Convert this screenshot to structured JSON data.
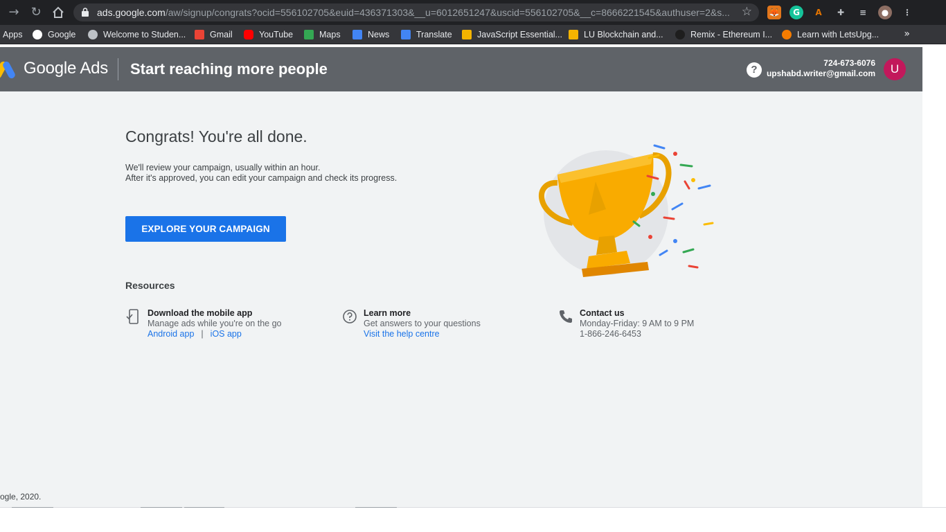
{
  "browser": {
    "url_host": "ads.google.com",
    "url_path": "/aw/signup/congrats?ocid=556102705&euid=436371303&__u=6012651247&uscid=556102705&__c=8666221545&authuser=2&s...",
    "bookmarks": [
      {
        "label": "Apps",
        "icon": "apps-grid-icon",
        "color": "#4285f4"
      },
      {
        "label": "Google",
        "icon": "google-g-icon",
        "color": "#ffffff"
      },
      {
        "label": "Welcome to Studen...",
        "icon": "globe-icon",
        "color": "#bdc1c6"
      },
      {
        "label": "Gmail",
        "icon": "gmail-icon",
        "color": "#ea4335"
      },
      {
        "label": "YouTube",
        "icon": "youtube-icon",
        "color": "#ff0000"
      },
      {
        "label": "Maps",
        "icon": "maps-icon",
        "color": "#34a853"
      },
      {
        "label": "News",
        "icon": "news-icon",
        "color": "#4285f4"
      },
      {
        "label": "Translate",
        "icon": "translate-icon",
        "color": "#4285f4"
      },
      {
        "label": "JavaScript Essential...",
        "icon": "slides-icon",
        "color": "#f4b400"
      },
      {
        "label": "LU Blockchain and...",
        "icon": "slides-icon",
        "color": "#f4b400"
      },
      {
        "label": "Remix - Ethereum I...",
        "icon": "remix-icon",
        "color": "#1e1e1e"
      },
      {
        "label": "Learn with LetsUpg...",
        "icon": "letsupgrade-icon",
        "color": "#f57c00"
      }
    ],
    "more_bookmarks": "»"
  },
  "header": {
    "product": "Google Ads",
    "page_title": "Start reaching more people",
    "help_glyph": "?",
    "account_phone": "724-673-6076",
    "account_email": "upshabd.writer@gmail.com",
    "avatar_letter": "U"
  },
  "main": {
    "heading": "Congrats! You're all done.",
    "desc_line1": "We'll review your campaign, usually within an hour.",
    "desc_line2": "After it's approved, you can edit your campaign and check its progress.",
    "cta": "EXPLORE YOUR CAMPAIGN",
    "resources_title": "Resources",
    "resources": {
      "mobile": {
        "title": "Download the mobile app",
        "desc": "Manage ads while you're on the go",
        "link_android": "Android app",
        "separator": "|",
        "link_ios": "iOS app"
      },
      "learn": {
        "title": "Learn more",
        "desc": "Get answers to your questions",
        "link": "Visit the help centre"
      },
      "contact": {
        "title": "Contact us",
        "hours": "Monday-Friday: 9 AM to 9 PM",
        "phone": "1-866-246-6453"
      }
    },
    "footer": "ogle, 2020."
  },
  "colors": {
    "accent": "#1a73e8",
    "header_bg": "#5f6368",
    "page_bg": "#f1f3f4",
    "avatar_bg": "#c2185b",
    "trophy_gold": "#f9ab00"
  }
}
